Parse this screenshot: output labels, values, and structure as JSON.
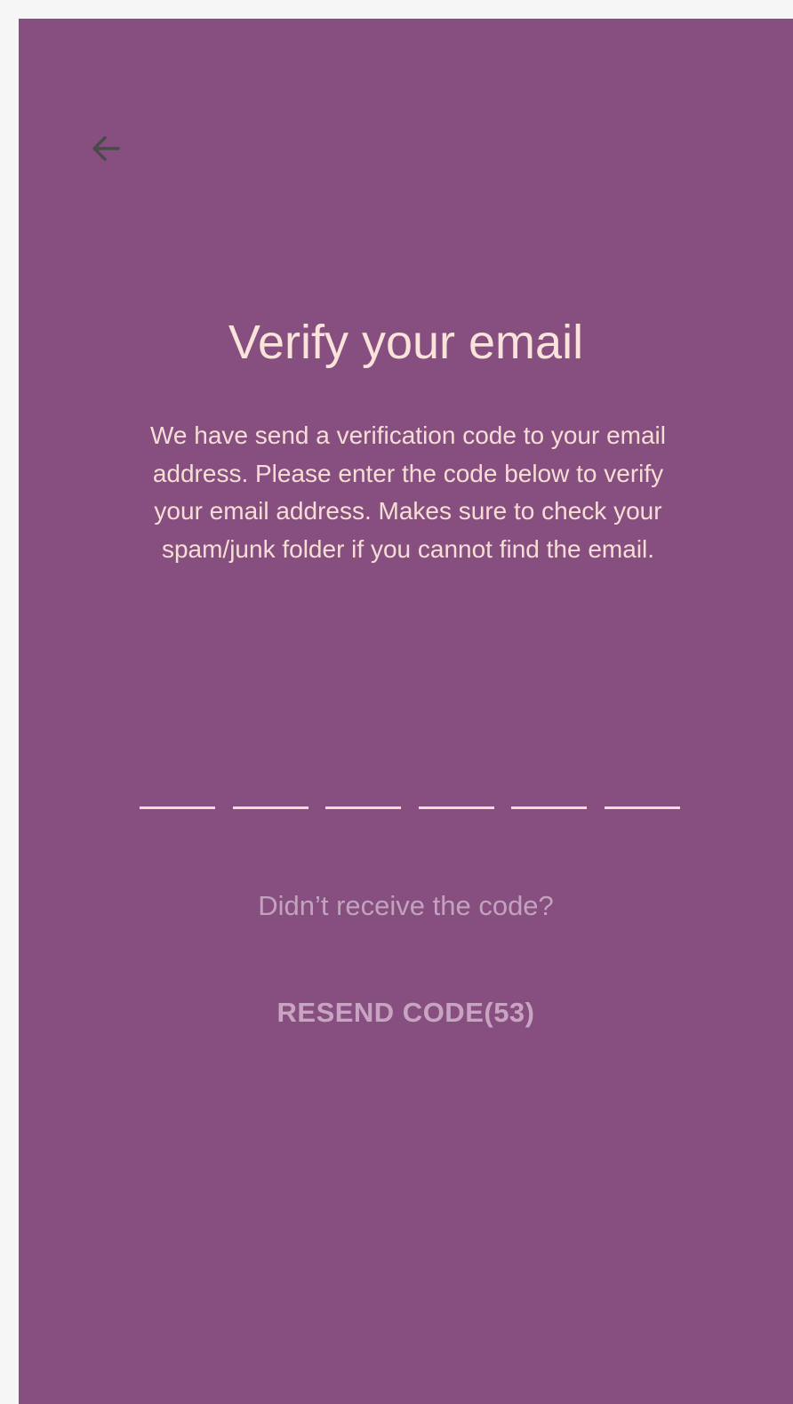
{
  "colors": {
    "background": "#874f80",
    "text_primary": "#f9e3da",
    "text_muted": "#c2a2bd",
    "resend_disabled": "#c8a4c2",
    "back_icon": "#4a4a4a"
  },
  "header": {
    "back_icon": "arrow-left-icon"
  },
  "main": {
    "title": "Verify your email",
    "description": "We have send a verification code to your email address. Please enter the code below to verify your email address. Makes sure to check your spam/junk folder if you cannot find the email.",
    "code_cells": [
      "",
      "",
      "",
      "",
      "",
      ""
    ],
    "didnt_receive_text": "Didn’t receive the code?",
    "resend_label": "RESEND CODE(53)"
  }
}
